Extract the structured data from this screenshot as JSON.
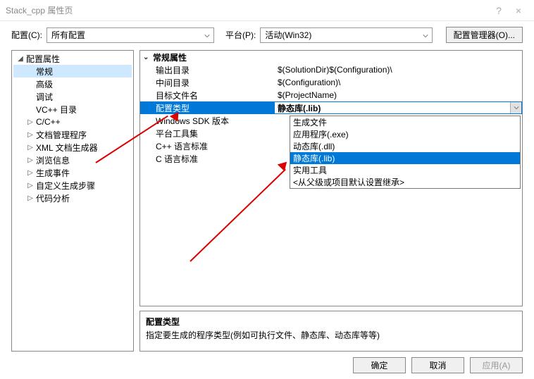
{
  "window": {
    "title": "Stack_cpp 属性页",
    "help": "?",
    "close": "×"
  },
  "toolbar": {
    "config_label": "配置(C):",
    "config_value": "所有配置",
    "platform_label": "平台(P):",
    "platform_value": "活动(Win32)",
    "manager_label": "配置管理器(O)..."
  },
  "tree": {
    "root": "配置属性",
    "items": [
      {
        "label": "常规",
        "selected": true
      },
      {
        "label": "高级"
      },
      {
        "label": "调试"
      },
      {
        "label": "VC++ 目录"
      },
      {
        "label": "C/C++",
        "expandable": true
      },
      {
        "label": "文档管理程序",
        "expandable": true
      },
      {
        "label": "XML 文档生成器",
        "expandable": true
      },
      {
        "label": "浏览信息",
        "expandable": true
      },
      {
        "label": "生成事件",
        "expandable": true
      },
      {
        "label": "自定义生成步骤",
        "expandable": true
      },
      {
        "label": "代码分析",
        "expandable": true
      }
    ]
  },
  "props": {
    "group": "常规属性",
    "rows": [
      {
        "name": "输出目录",
        "value": "$(SolutionDir)$(Configuration)\\"
      },
      {
        "name": "中间目录",
        "value": "$(Configuration)\\"
      },
      {
        "name": "目标文件名",
        "value": "$(ProjectName)"
      },
      {
        "name": "配置类型",
        "value": "静态库(.lib)",
        "selected": true
      },
      {
        "name": "Windows SDK 版本",
        "value": ""
      },
      {
        "name": "平台工具集",
        "value": ""
      },
      {
        "name": "C++ 语言标准",
        "value": ""
      },
      {
        "name": "C 语言标准",
        "value": ""
      }
    ]
  },
  "dropdown": {
    "items": [
      {
        "label": "生成文件"
      },
      {
        "label": "应用程序(.exe)"
      },
      {
        "label": "动态库(.dll)"
      },
      {
        "label": "静态库(.lib)",
        "selected": true
      },
      {
        "label": "实用工具"
      },
      {
        "label": "<从父级或项目默认设置继承>"
      }
    ]
  },
  "desc": {
    "title": "配置类型",
    "text": "指定要生成的程序类型(例如可执行文件、静态库、动态库等等)"
  },
  "buttons": {
    "ok": "确定",
    "cancel": "取消",
    "apply": "应用(A)"
  }
}
